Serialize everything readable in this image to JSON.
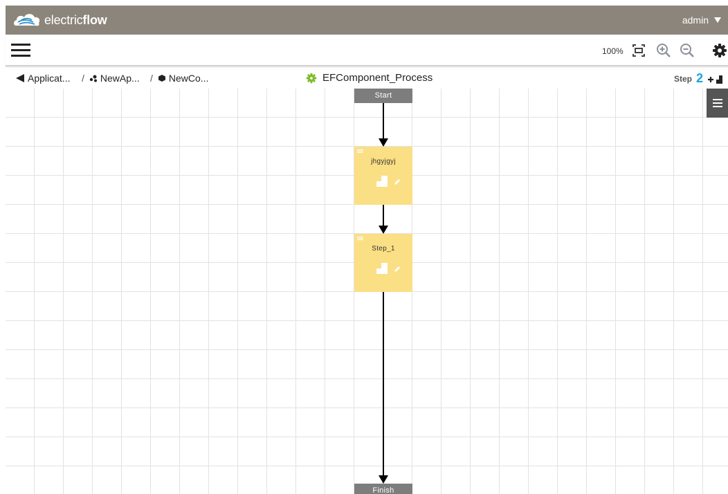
{
  "brand": {
    "name_light": "electric",
    "name_bold": "flow"
  },
  "user": {
    "name": "admin"
  },
  "toolbar": {
    "zoom": "100%"
  },
  "breadcrumb": [
    {
      "label": "Applicat..."
    },
    {
      "label": "NewAp..."
    },
    {
      "label": "NewCo..."
    }
  ],
  "process": {
    "title": "EFComponent_Process"
  },
  "steps": {
    "label": "Step",
    "count": "2"
  },
  "flow": {
    "start_label": "Start",
    "finish_label": "Finish",
    "nodes": [
      {
        "name": "jhgyjgyj"
      },
      {
        "name": "Step_1"
      }
    ]
  },
  "colors": {
    "header_bg": "#8c857b",
    "step_node": "#fbdf85",
    "terminal_node": "#7d7d7d",
    "accent": "#1aa3d8",
    "gear_green": "#7dbb2a"
  },
  "icons": {
    "logo": "cloud-logo-icon",
    "menu": "hamburger-menu-icon",
    "fit": "fit-to-screen-icon",
    "zoom_in": "zoom-in-icon",
    "zoom_out": "zoom-out-icon",
    "settings": "gear-icon",
    "back": "back-arrow-icon",
    "process": "process-gear-icon",
    "add_step": "add-step-icon"
  }
}
